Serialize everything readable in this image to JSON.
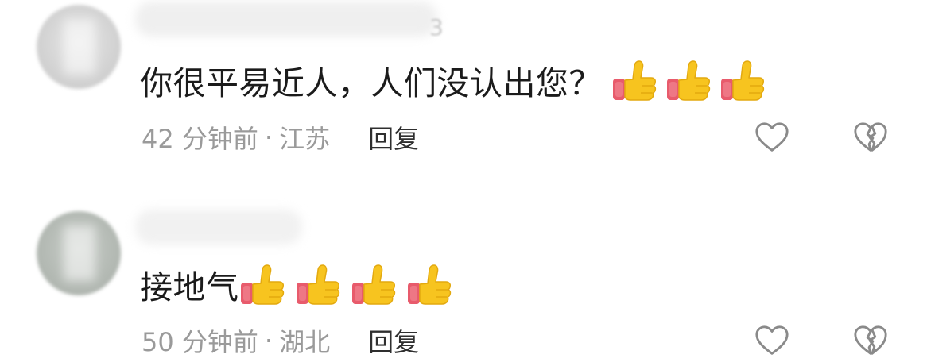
{
  "comments": [
    {
      "username_tail": "3",
      "text": "你很平易近人，人们没认出您？",
      "emoji_count": 3,
      "time": "42 分钟前",
      "separator": "·",
      "location": "江苏",
      "reply_label": "回复"
    },
    {
      "text": "接地气",
      "emoji_count": 4,
      "time": "50 分钟前",
      "separator": "·",
      "location": "湖北",
      "reply_label": "回复"
    }
  ],
  "icons": {
    "emoji": "thumbs-up-icon",
    "like": "heart-outline-icon",
    "dislike": "broken-heart-icon"
  },
  "colors": {
    "text": "#1b1b1b",
    "meta": "#9a9a9a",
    "reply": "#2f2f2f",
    "icon": "#8a8a8a",
    "thumb_yellow": "#F7C41F",
    "thumb_cuff": "#E85B6C"
  }
}
